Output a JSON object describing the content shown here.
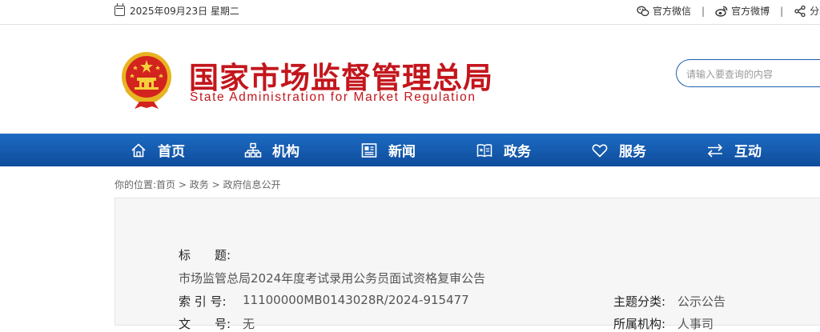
{
  "topbar": {
    "date": "2025年09月23日 星期二",
    "wechat_label": "官方微信",
    "weibo_label": "官方微博",
    "share_label": "分享",
    "separator": "|"
  },
  "header": {
    "title_cn": "国家市场监督管理总局",
    "title_en": "State Administration for Market Regulation",
    "search_placeholder": "请输入要查询的内容"
  },
  "nav": {
    "items": [
      {
        "label": "首页",
        "icon": "home-icon"
      },
      {
        "label": "机构",
        "icon": "org-chart-icon"
      },
      {
        "label": "新闻",
        "icon": "news-icon"
      },
      {
        "label": "政务",
        "icon": "book-star-icon"
      },
      {
        "label": "服务",
        "icon": "heart-icon"
      },
      {
        "label": "互动",
        "icon": "exchange-arrows-icon"
      }
    ]
  },
  "breadcrumb": {
    "prefix": "你的位置:",
    "items": [
      "首页",
      "政务",
      "政府信息公开"
    ],
    "separator": " > "
  },
  "article_meta": {
    "title_label": "标　　题:",
    "title_value": "市场监管总局2024年度考试录用公务员面试资格复审公告",
    "index_label": "索 引 号:",
    "index_value": "11100000MB0143028R/2024-915477",
    "category_label": "主题分类:",
    "category_value": "公示公告",
    "partial_label_1": "文　　号:",
    "partial_value_1": "无",
    "partial_label_2": "所属机构:",
    "partial_value_2": "人事司"
  },
  "colors": {
    "brand_red": "#c3161c",
    "nav_blue": "#1565b8"
  }
}
